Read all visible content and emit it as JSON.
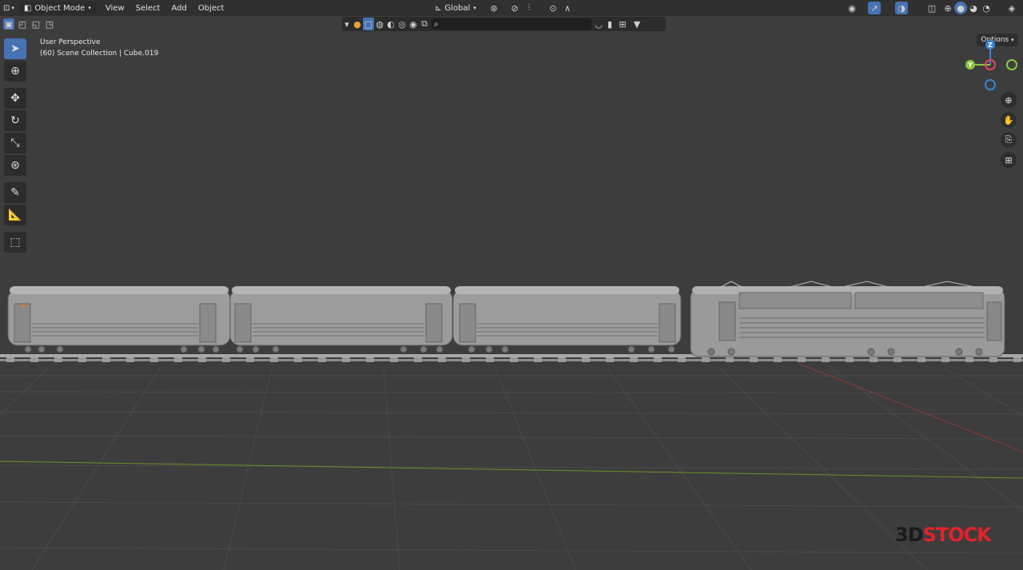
{
  "header": {
    "mode": "Object Mode",
    "menu": [
      "View",
      "Select",
      "Add",
      "Object"
    ],
    "orientation": "Global"
  },
  "viewport": {
    "perspective": "User Perspective",
    "collection": "(60) Scene Collection | Cube.019",
    "options_label": "Options"
  },
  "gizmo": {
    "z": "Z",
    "y": "Y"
  },
  "left_tools": [
    "select-box-tool",
    "cursor-tool",
    "move-tool",
    "rotate-tool",
    "scale-tool",
    "transform-tool",
    "annotate-tool",
    "measure-tool",
    "add-cube-tool"
  ],
  "right_nav": [
    "zoom-icon",
    "pan-hand-icon",
    "camera-view-icon",
    "ortho-grid-icon"
  ],
  "watermark": {
    "part1": "3D",
    "part2": "STOCK"
  },
  "colors": {
    "accent": "#4772b3",
    "x_axis": "#e8435a",
    "y_axis": "#8cc63f",
    "z_axis": "#3b82d8"
  }
}
